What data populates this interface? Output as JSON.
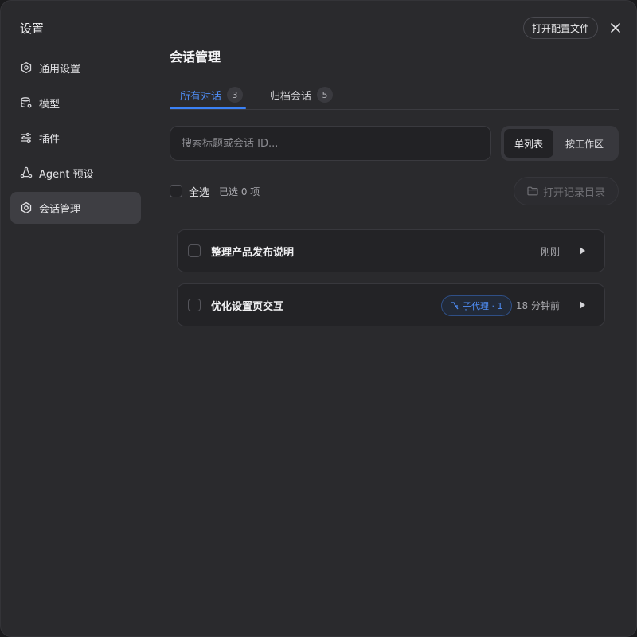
{
  "sidebar": {
    "title": "设置",
    "items": [
      {
        "label": "通用设置",
        "icon": "gear-icon"
      },
      {
        "label": "模型",
        "icon": "database-icon"
      },
      {
        "label": "插件",
        "icon": "sliders-icon"
      },
      {
        "label": "Agent 预设",
        "icon": "agent-icon"
      },
      {
        "label": "会话管理",
        "icon": "gear-icon",
        "active": true
      }
    ]
  },
  "header": {
    "open_config_label": "打开配置文件",
    "close_icon": "close-icon"
  },
  "main": {
    "title": "会话管理",
    "tabs": [
      {
        "label": "所有对话",
        "count": "3",
        "active": true
      },
      {
        "label": "归档会话",
        "count": "5"
      }
    ],
    "search": {
      "placeholder": "搜索标题或会话 ID...",
      "value": ""
    },
    "view_toggle": {
      "options": [
        "单列表",
        "按工作区"
      ],
      "selected": "单列表"
    },
    "select_all_label": "全选",
    "selected_count": "已选 0 项",
    "open_log_label": "打开记录目录",
    "conversations": [
      {
        "title": "整理产品发布说明",
        "time": "刚刚"
      },
      {
        "title": "优化设置页交互",
        "badge": "子代理 · 1",
        "time": "18 分钟前"
      }
    ]
  },
  "colors": {
    "accent": "#3b82f6",
    "background": "#2a2a2d",
    "active_nav": "#3e3e43"
  }
}
